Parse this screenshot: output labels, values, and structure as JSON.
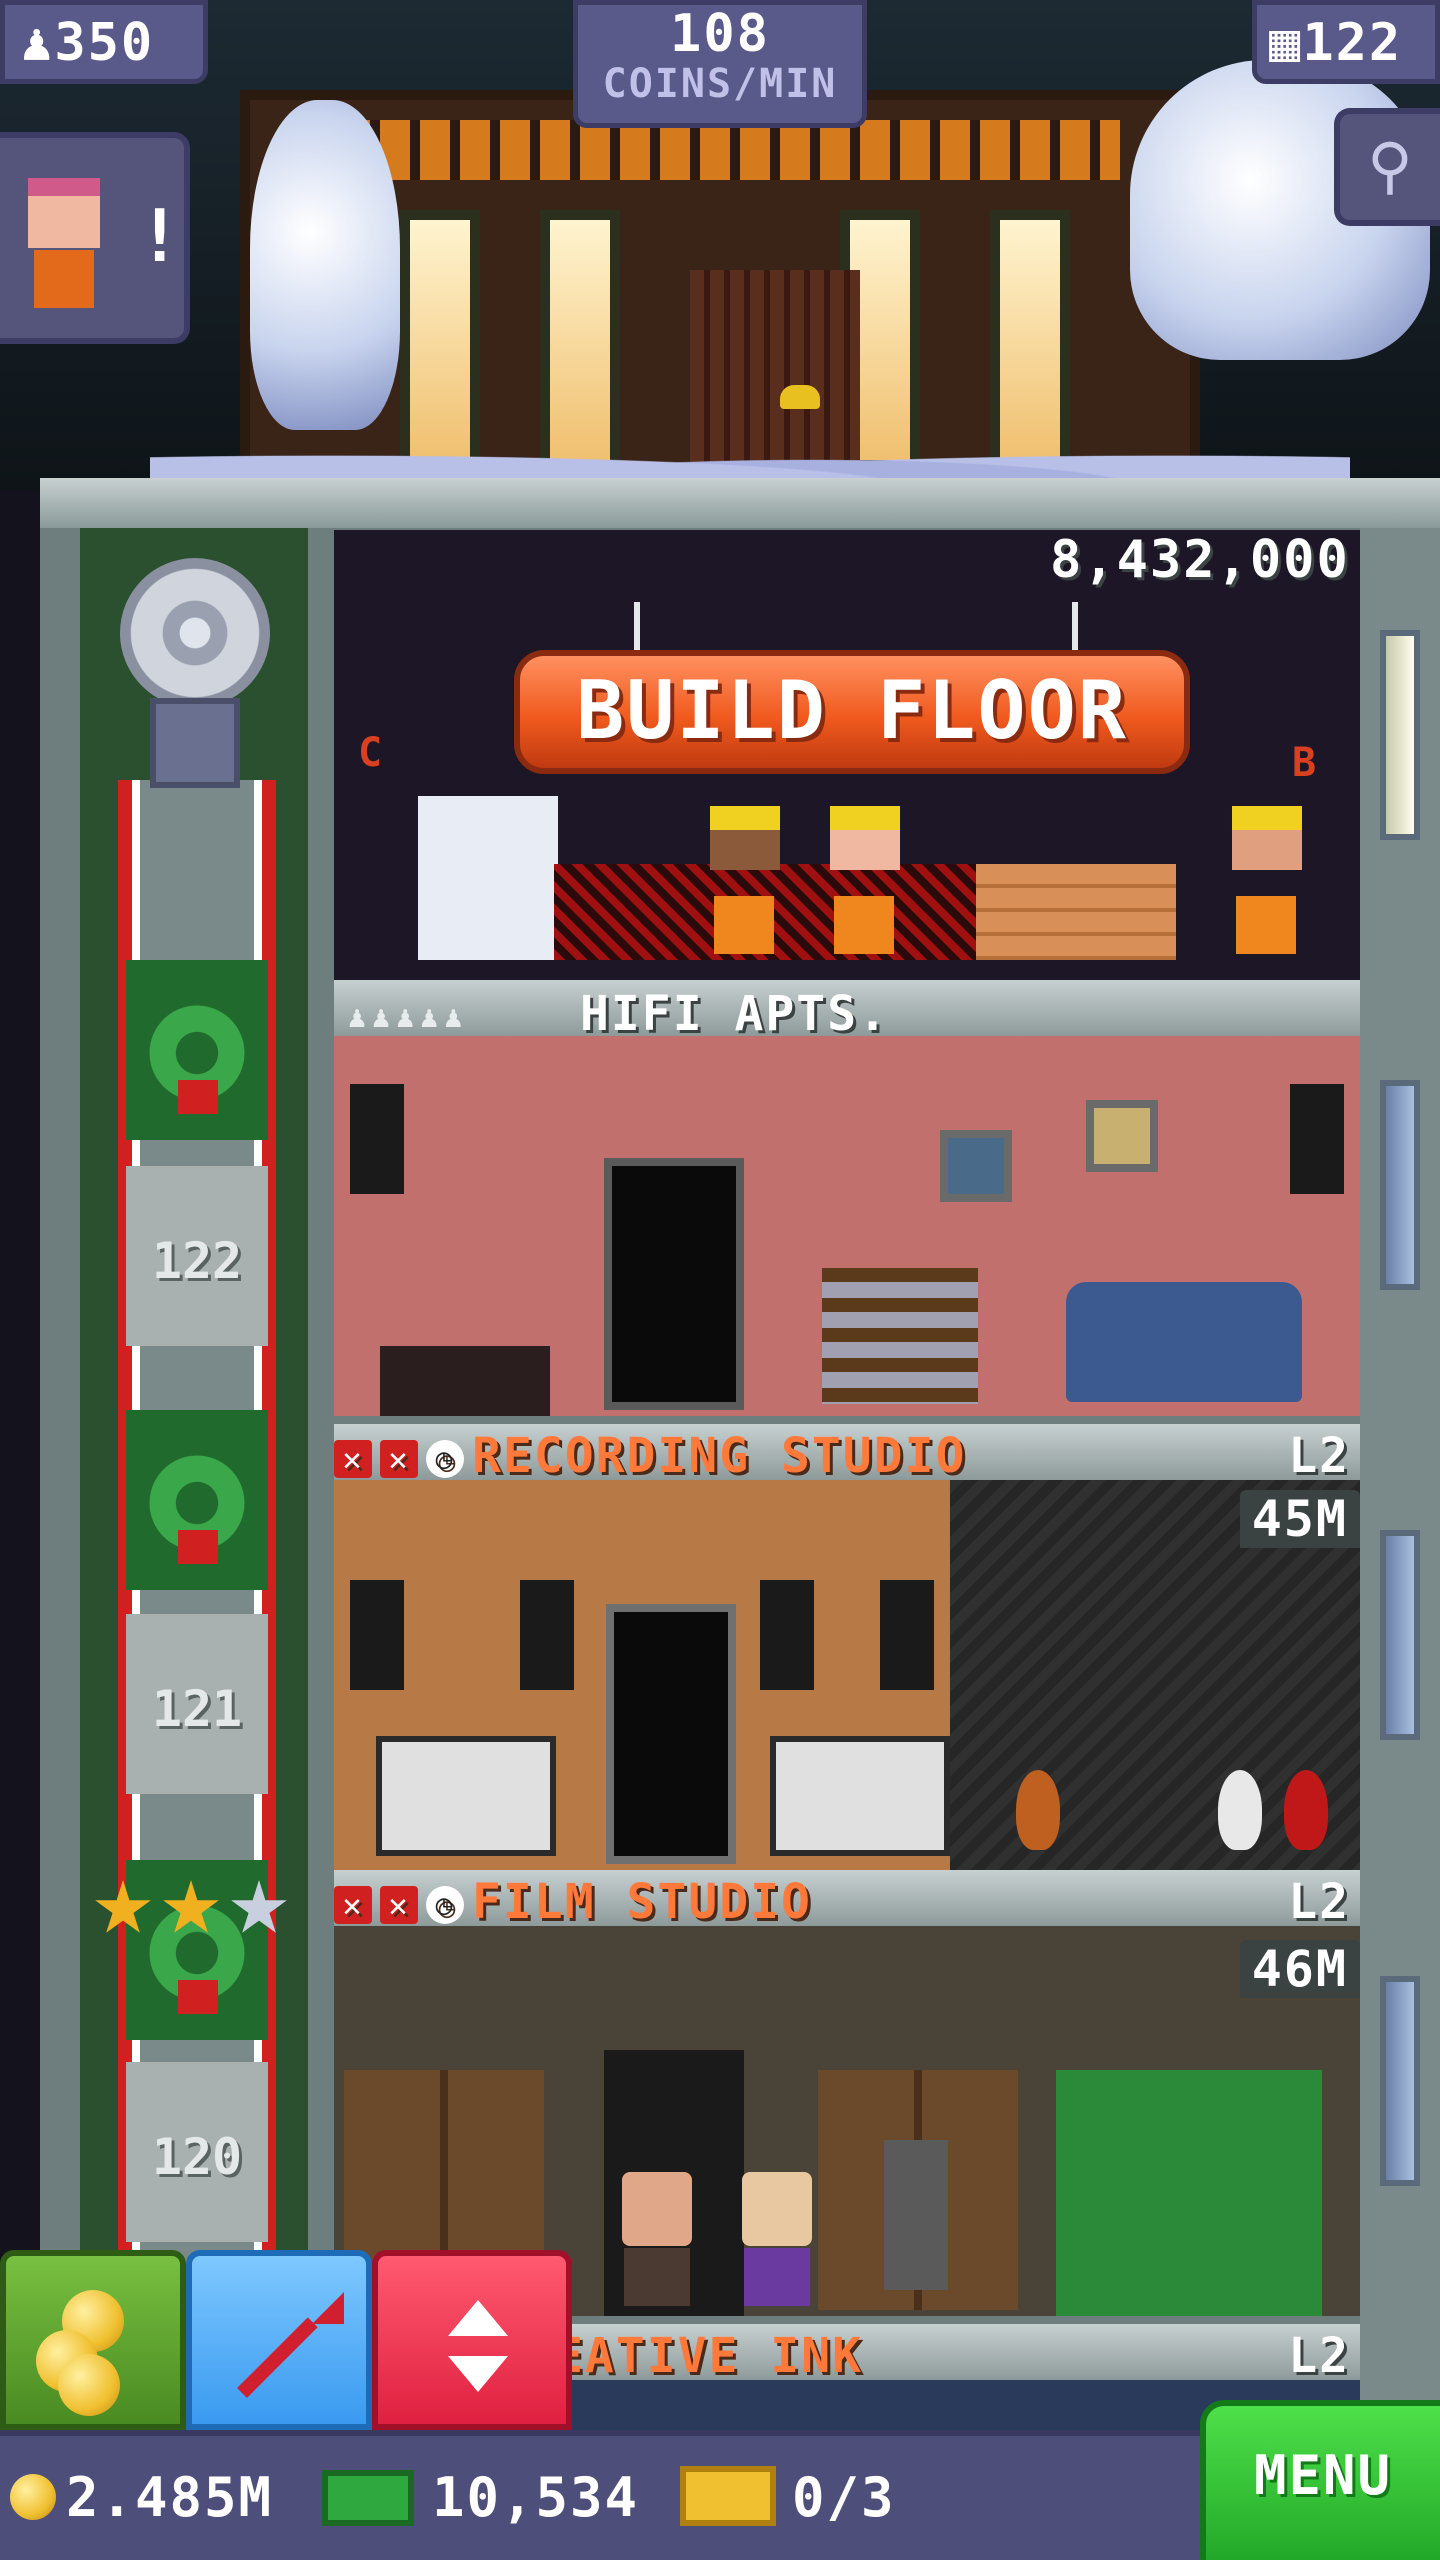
{
  "top_bar": {
    "bux": "350",
    "coins_per_min_value": "108",
    "coins_per_min_label": "COINS/MIN",
    "floor_count": "122"
  },
  "vip": {
    "alert": "!"
  },
  "construction": {
    "cost": "8,432,000",
    "button_label": "BUILD FLOOR",
    "left_marker": "C",
    "right_marker": "B"
  },
  "floors": [
    {
      "name": "HIFI APTS.",
      "level": "",
      "price": ""
    },
    {
      "name": "RECORDING STUDIO",
      "level": "L2",
      "price": "45M",
      "shaft_number": "122"
    },
    {
      "name": "FILM STUDIO",
      "level": "L2",
      "price": "46M",
      "shaft_number": "121"
    },
    {
      "name": "EATIVE INK",
      "level": "L2",
      "price": "",
      "shaft_number": "120"
    }
  ],
  "bottom_bar": {
    "coins": "2.485M",
    "tower_bux": "10,534",
    "tickets": "0/3",
    "menu_label": "MENU"
  },
  "icons": {
    "people": "person-icon",
    "floors": "building-icon",
    "search": "magnifier-icon",
    "stop": "x-icon",
    "timer": "clock-icon"
  },
  "colors": {
    "accent_orange": "#f05a1e",
    "menu_green": "#22a828",
    "panel_purple": "#5a5a8a",
    "elevator_red": "#e02040",
    "pin_blue": "#3a9af0",
    "coins_green": "#4a8a22"
  }
}
